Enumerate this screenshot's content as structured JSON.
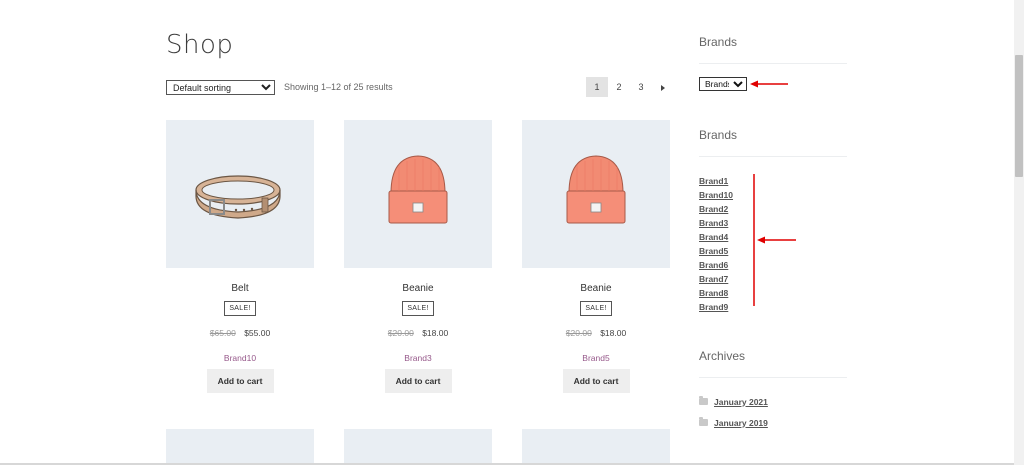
{
  "page": {
    "title": "Shop"
  },
  "toolbar": {
    "sort_selected": "Default sorting",
    "result_count": "Showing 1–12 of 25 results",
    "pagination": [
      "1",
      "2",
      "3"
    ],
    "next_icon": "caret-right-icon"
  },
  "products": [
    {
      "name": "Belt",
      "sale": "SALE!",
      "old_price": "$65.00",
      "price": "$55.00",
      "brand": "Brand10",
      "cart": "Add to cart",
      "image": "belt-image"
    },
    {
      "name": "Beanie",
      "sale": "SALE!",
      "old_price": "$20.00",
      "price": "$18.00",
      "brand": "Brand3",
      "cart": "Add to cart",
      "image": "beanie-image"
    },
    {
      "name": "Beanie",
      "sale": "SALE!",
      "old_price": "$20.00",
      "price": "$18.00",
      "brand": "Brand5",
      "cart": "Add to cart",
      "image": "beanie-image"
    }
  ],
  "sidebar": {
    "brands_dropdown_title": "Brands",
    "brands_dropdown_selected": "Brands",
    "brands_list_title": "Brands",
    "brands": [
      "Brand1",
      "Brand10",
      "Brand2",
      "Brand3",
      "Brand4",
      "Brand5",
      "Brand6",
      "Brand7",
      "Brand8",
      "Brand9"
    ],
    "archives_title": "Archives",
    "archives": [
      "January 2021",
      "January 2019"
    ]
  },
  "colors": {
    "brand_link": "#96588a",
    "annotation": "#e00000",
    "thumb_bg": "#e9eef3"
  }
}
